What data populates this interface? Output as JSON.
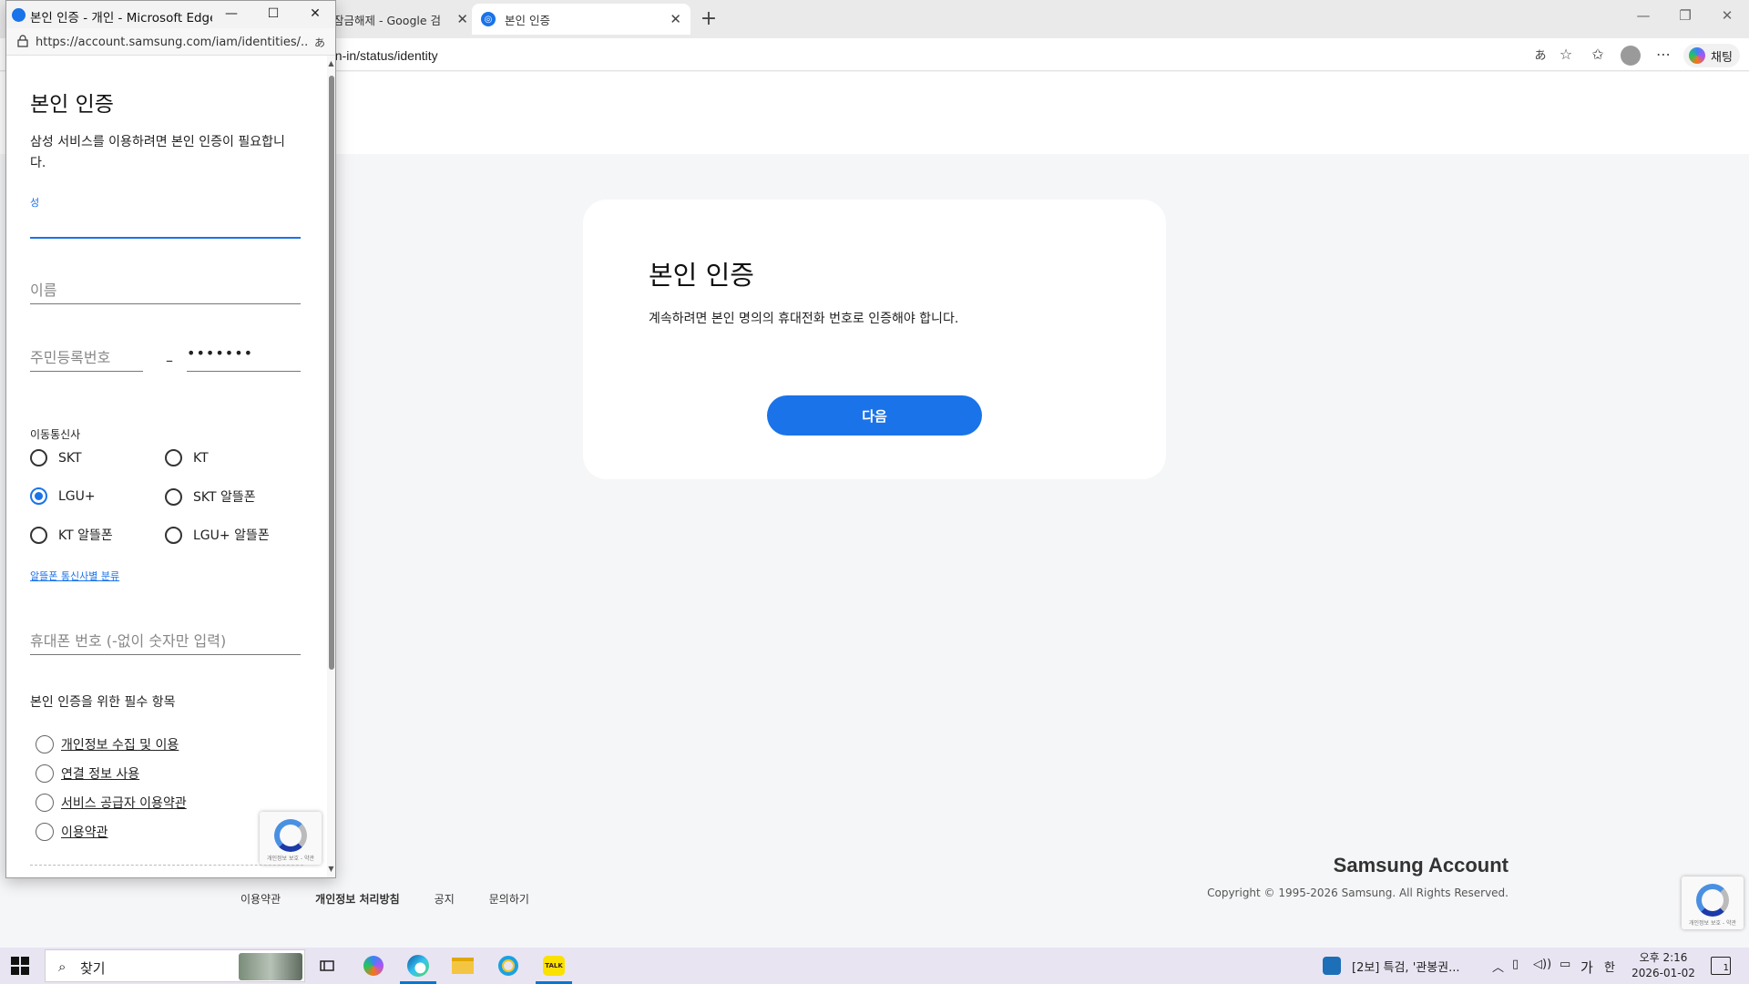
{
  "browser": {
    "tabs": [
      {
        "label": "잠금해제 - Google 검",
        "active": false
      },
      {
        "label": "본인 인증",
        "active": true
      }
    ],
    "url": "gn-in/status/identity",
    "copilot_label": "채팅"
  },
  "main": {
    "card_title": "본인 인증",
    "card_desc": "계속하려면 본인 명의의 휴대전화 번호로 인증해야 합니다.",
    "next_label": "다음",
    "brand": "Samsung Account",
    "copyright": "Copyright © 1995-2026 Samsung. All Rights Reserved.",
    "footer_links": [
      "이용약관",
      "개인정보 처리방침",
      "공지",
      "문의하기"
    ],
    "recaptcha_text": "개인정보 보호 - 약관"
  },
  "popup": {
    "title": "본인 인증 - 개인 - Microsoft Edge",
    "url": "https://account.samsung.com/iam/identities/...",
    "heading": "본인 인증",
    "description": "삼성 서비스를 이용하려면 본인 인증이 필요합니다.",
    "lastname_label": "성",
    "lastname_value": "",
    "firstname_placeholder": "이름",
    "rrn_front_placeholder": "주민등록번호",
    "rrn_back_mask": "•••••••",
    "carrier_label": "이동통신사",
    "carriers": [
      "SKT",
      "KT",
      "LGU+",
      "SKT 알뜰폰",
      "KT 알뜰폰",
      "LGU+ 알뜰폰"
    ],
    "selected_carrier": "LGU+",
    "mvno_link": "알뜰폰 통신사별 분류",
    "phone_placeholder": "휴대폰 번호 (-없이 숫자만 입력)",
    "consent_heading": "본인 인증을 위한 필수 항목",
    "consents": [
      "개인정보 수집 및 이용",
      "연결 정보 사용",
      "서비스 공급자 이용약관",
      "이용약관"
    ]
  },
  "taskbar": {
    "search_text": "찾기",
    "news_text": "[2보] 특검, '관봉권...",
    "ime_lang": "가",
    "ime_mode": "한",
    "time": "오후 2:16",
    "date": "2026-01-02",
    "notification_count": "1"
  },
  "colors": {
    "accent": "#1a73e8",
    "page_bg": "#f5f6f8",
    "taskbar_bg": "#e9e4f2"
  }
}
